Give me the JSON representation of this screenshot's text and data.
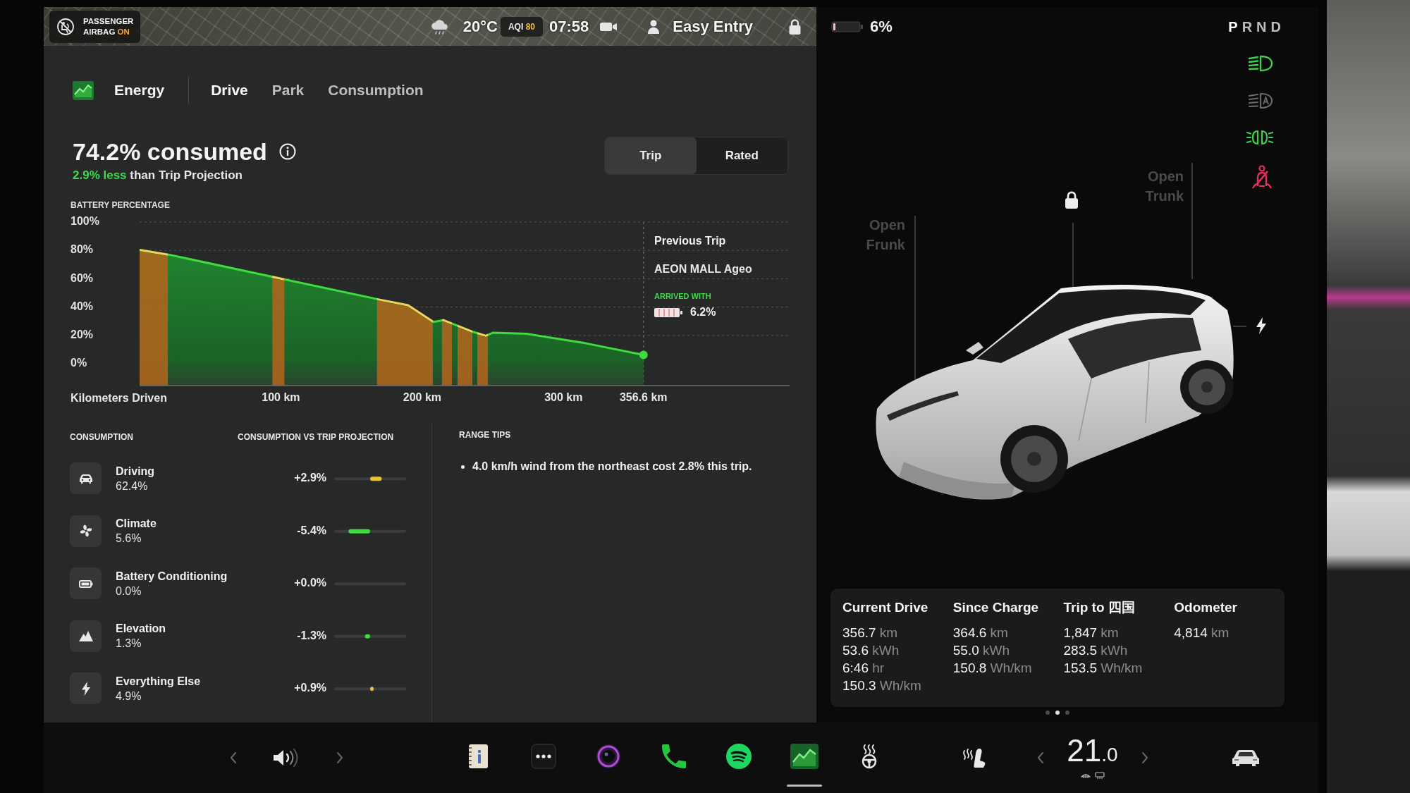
{
  "status_bar": {
    "airbag": {
      "lines": [
        "PASSENGER",
        "AIRBAG"
      ],
      "state": "ON"
    },
    "outside_temperature": "20°C",
    "aqi": {
      "label": "AQI",
      "value": "80"
    },
    "time": "07:58",
    "driver_profile": "Easy Entry"
  },
  "energy_app": {
    "title": "Energy",
    "tabs": [
      {
        "label": "Drive",
        "selected": true
      },
      {
        "label": "Park",
        "selected": false
      },
      {
        "label": "Consumption",
        "selected": false
      }
    ],
    "headline": "74.2% consumed",
    "comparison": {
      "highlight": "2.9% less",
      "rest": "than Trip Projection"
    },
    "mode_toggle": [
      {
        "label": "Trip",
        "selected": true
      },
      {
        "label": "Rated",
        "selected": false
      }
    ],
    "chart_data": {
      "type": "area",
      "xlabel": "Kilometers Driven",
      "ylabel": "BATTERY PERCENTAGE",
      "x": [
        0,
        21,
        93,
        170,
        190,
        208,
        215,
        236,
        245,
        250,
        274,
        316,
        356.6
      ],
      "series": [
        {
          "color": "#3ddc3d",
          "values": [
            80.4,
            76.9,
            61.6,
            45.2,
            41.3,
            29.5,
            30.8,
            22.5,
            19.7,
            21.9,
            21.1,
            14.4,
            6.2
          ]
        }
      ],
      "xlim": [
        0,
        460
      ],
      "ylim": [
        0,
        100
      ],
      "grid": true,
      "yticks": [
        {
          "value": 100,
          "label": "100%"
        },
        {
          "value": 80,
          "label": "80%"
        },
        {
          "value": 60,
          "label": "60%"
        },
        {
          "value": 40,
          "label": "40%"
        },
        {
          "value": 20,
          "label": "20%"
        },
        {
          "value": 0,
          "label": "0%"
        }
      ],
      "xticks": [
        {
          "value": 100,
          "label": "100 km"
        },
        {
          "value": 200,
          "label": "200 km"
        },
        {
          "value": 300,
          "label": "300 km"
        },
        {
          "value": 356.6,
          "label": "356.6 km"
        }
      ],
      "bands": [
        {
          "axis": "x",
          "from": 0,
          "to": 20,
          "color": "#b5651d"
        },
        {
          "axis": "x",
          "from": 94,
          "to": 102.5,
          "color": "#b5651d"
        },
        {
          "axis": "x",
          "from": 168,
          "to": 207.5,
          "color": "#b5651d"
        },
        {
          "axis": "x",
          "from": 214,
          "to": 221,
          "color": "#b5651d"
        },
        {
          "axis": "x",
          "from": 225,
          "to": 235.5,
          "color": "#b5651d"
        },
        {
          "axis": "x",
          "from": 239,
          "to": 246.5,
          "color": "#b5651d"
        }
      ],
      "ref_lines": [
        {
          "axis": "x",
          "value": 356.6
        }
      ]
    },
    "previous_trip": {
      "title": "Previous Trip",
      "destination": "AEON MALL Ageo",
      "arrived_label": "ARRIVED WITH",
      "arrived_value": "6.2%"
    },
    "consumption": {
      "heading": "CONSUMPTION",
      "items": [
        {
          "kind": "driving",
          "share": "62.4%"
        },
        {
          "kind": "climate",
          "share": "5.6%"
        },
        {
          "kind": "battery",
          "share": "0.0%"
        },
        {
          "kind": "elevation",
          "share": "1.3%"
        },
        {
          "kind": "other",
          "share": "4.9%"
        }
      ],
      "chart_data": {
        "type": "bar",
        "orientation": "horizontal",
        "title": "CONSUMPTION VS TRIP PROJECTION",
        "categories": [
          "Driving",
          "Climate",
          "Battery Conditioning",
          "Elevation",
          "Everything Else"
        ],
        "values": [
          2.9,
          -5.4,
          0,
          -1.3,
          0.9
        ],
        "value_labels": [
          "+2.9%",
          "-5.4%",
          "+0.0%",
          "-1.3%",
          "+0.9%"
        ],
        "xlim": [
          -9,
          9
        ],
        "grid": true
      }
    },
    "range_tips": {
      "heading": "RANGE TIPS",
      "tips": [
        "4.0 km/h wind from the northeast cost 2.8% this trip."
      ]
    }
  },
  "vehicle": {
    "battery": "6%",
    "gears": [
      {
        "label": "P",
        "selected": true
      },
      {
        "label": "R",
        "selected": false
      },
      {
        "label": "N",
        "selected": false
      },
      {
        "label": "D",
        "selected": false
      }
    ],
    "indicators": [
      {
        "kind": "headlights",
        "on": true
      },
      {
        "kind": "auto_headlights",
        "on": false
      },
      {
        "kind": "parking_lights",
        "on": true
      },
      {
        "kind": "seatbelt_warning",
        "on": true
      }
    ],
    "frunk_label": "Open Frunk",
    "trunk_label": "Open Trunk",
    "stats": [
      {
        "title": "Current Drive",
        "values": [
          {
            "number": "356.7",
            "unit": "km"
          },
          {
            "number": "53.6",
            "unit": "kWh"
          },
          {
            "number": "6:46",
            "unit": "hr"
          },
          {
            "number": "150.3",
            "unit": "Wh/km"
          }
        ]
      },
      {
        "title": "Since Charge",
        "values": [
          {
            "number": "364.6",
            "unit": "km"
          },
          {
            "number": "55.0",
            "unit": "kWh"
          },
          {
            "number": "150.8",
            "unit": "Wh/km"
          }
        ]
      },
      {
        "title": "Trip to 四国",
        "values": [
          {
            "number": "1,847",
            "unit": "km"
          },
          {
            "number": "283.5",
            "unit": "kWh"
          },
          {
            "number": "153.5",
            "unit": "Wh/km"
          }
        ]
      },
      {
        "title": "Odometer",
        "values": [
          {
            "number": "4,814",
            "unit": "km"
          }
        ]
      }
    ],
    "pages": [
      {
        "selected": false
      },
      {
        "selected": true
      },
      {
        "selected": false
      }
    ]
  },
  "dock": {
    "apps": [
      {
        "kind": "notes",
        "selected": false
      },
      {
        "kind": "more",
        "selected": false
      },
      {
        "kind": "camera",
        "selected": false
      },
      {
        "kind": "phone",
        "selected": false
      },
      {
        "kind": "music",
        "selected": false
      },
      {
        "kind": "energy",
        "selected": true
      },
      {
        "kind": "wheel_heat",
        "selected": false
      }
    ],
    "cabin_temperature": {
      "whole": "21",
      "fraction": ".0"
    }
  }
}
